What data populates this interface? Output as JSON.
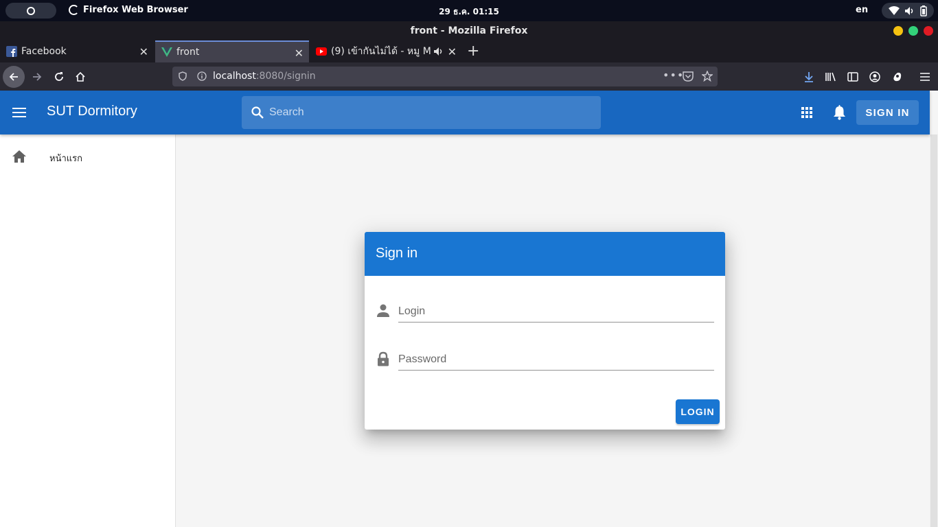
{
  "os": {
    "app_name": "Firefox Web Browser",
    "clock": "29 ธ.ค.  01:15",
    "lang": "en"
  },
  "browser": {
    "window_title": "front - Mozilla Firefox",
    "tabs": [
      {
        "label": "Facebook"
      },
      {
        "label": "front"
      },
      {
        "label": "(9) เข้ากันไม่ได้ - หมู M"
      }
    ],
    "url_host": "localhost",
    "url_path": ":8080/signin"
  },
  "app": {
    "title": "SUT Dormitory",
    "search_placeholder": "Search",
    "signin_label": "SIGN IN",
    "drawer_items": [
      {
        "label": "หน้าแรก"
      }
    ]
  },
  "signin_card": {
    "title": "Sign in",
    "login_placeholder": "Login",
    "password_placeholder": "Password",
    "login_button": "LOGIN"
  },
  "colors": {
    "appbar": "#1867c0",
    "card_header": "#1976d2",
    "primary_button": "#1976d2"
  }
}
